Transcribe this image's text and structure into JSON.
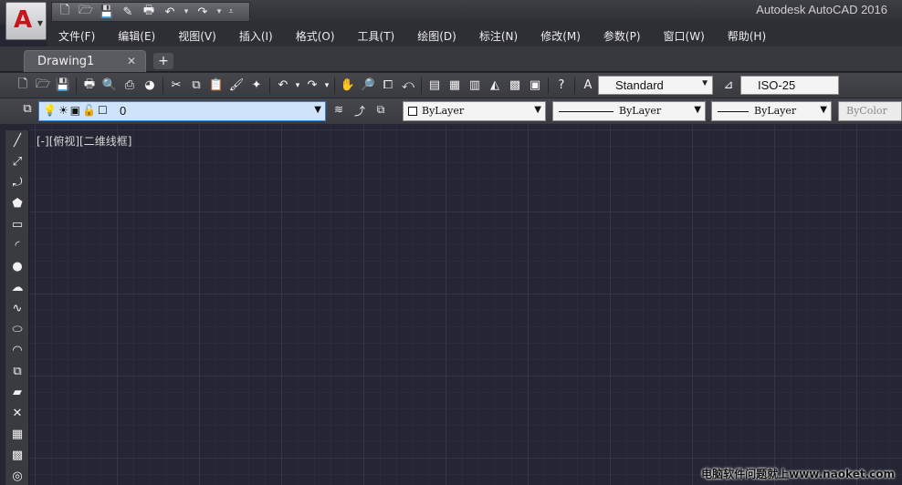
{
  "titlebar": {
    "app_title": "Autodesk AutoCAD 2016",
    "app_button_letter": "A",
    "qat_icons": [
      "new-icon",
      "open-icon",
      "save-icon",
      "save-as-icon",
      "plot-icon",
      "undo-icon",
      "redo-icon",
      "customize-icon"
    ]
  },
  "menu": {
    "items": [
      "文件(F)",
      "编辑(E)",
      "视图(V)",
      "插入(I)",
      "格式(O)",
      "工具(T)",
      "绘图(D)",
      "标注(N)",
      "修改(M)",
      "参数(P)",
      "窗口(W)",
      "帮助(H)"
    ]
  },
  "tabs": {
    "active": "Drawing1",
    "close_glyph": "✕",
    "new_glyph": "+"
  },
  "toolbar": {
    "text_style": "Standard",
    "dim_style": "ISO-25"
  },
  "layers": {
    "current_layer": "0",
    "color": "ByLayer",
    "linetype": "ByLayer",
    "lineweight": "ByLayer",
    "plot_style": "ByColor"
  },
  "canvas": {
    "viewport_label": "[-][俯视][二维线框]",
    "watermark": "电脑软件问题就上www.naoket.com"
  },
  "colors": {
    "canvas_bg": "#252634",
    "ui_dark": "#3a3b40",
    "layer_highlight": "#cfe3fb",
    "brand_red": "#c8141a"
  }
}
